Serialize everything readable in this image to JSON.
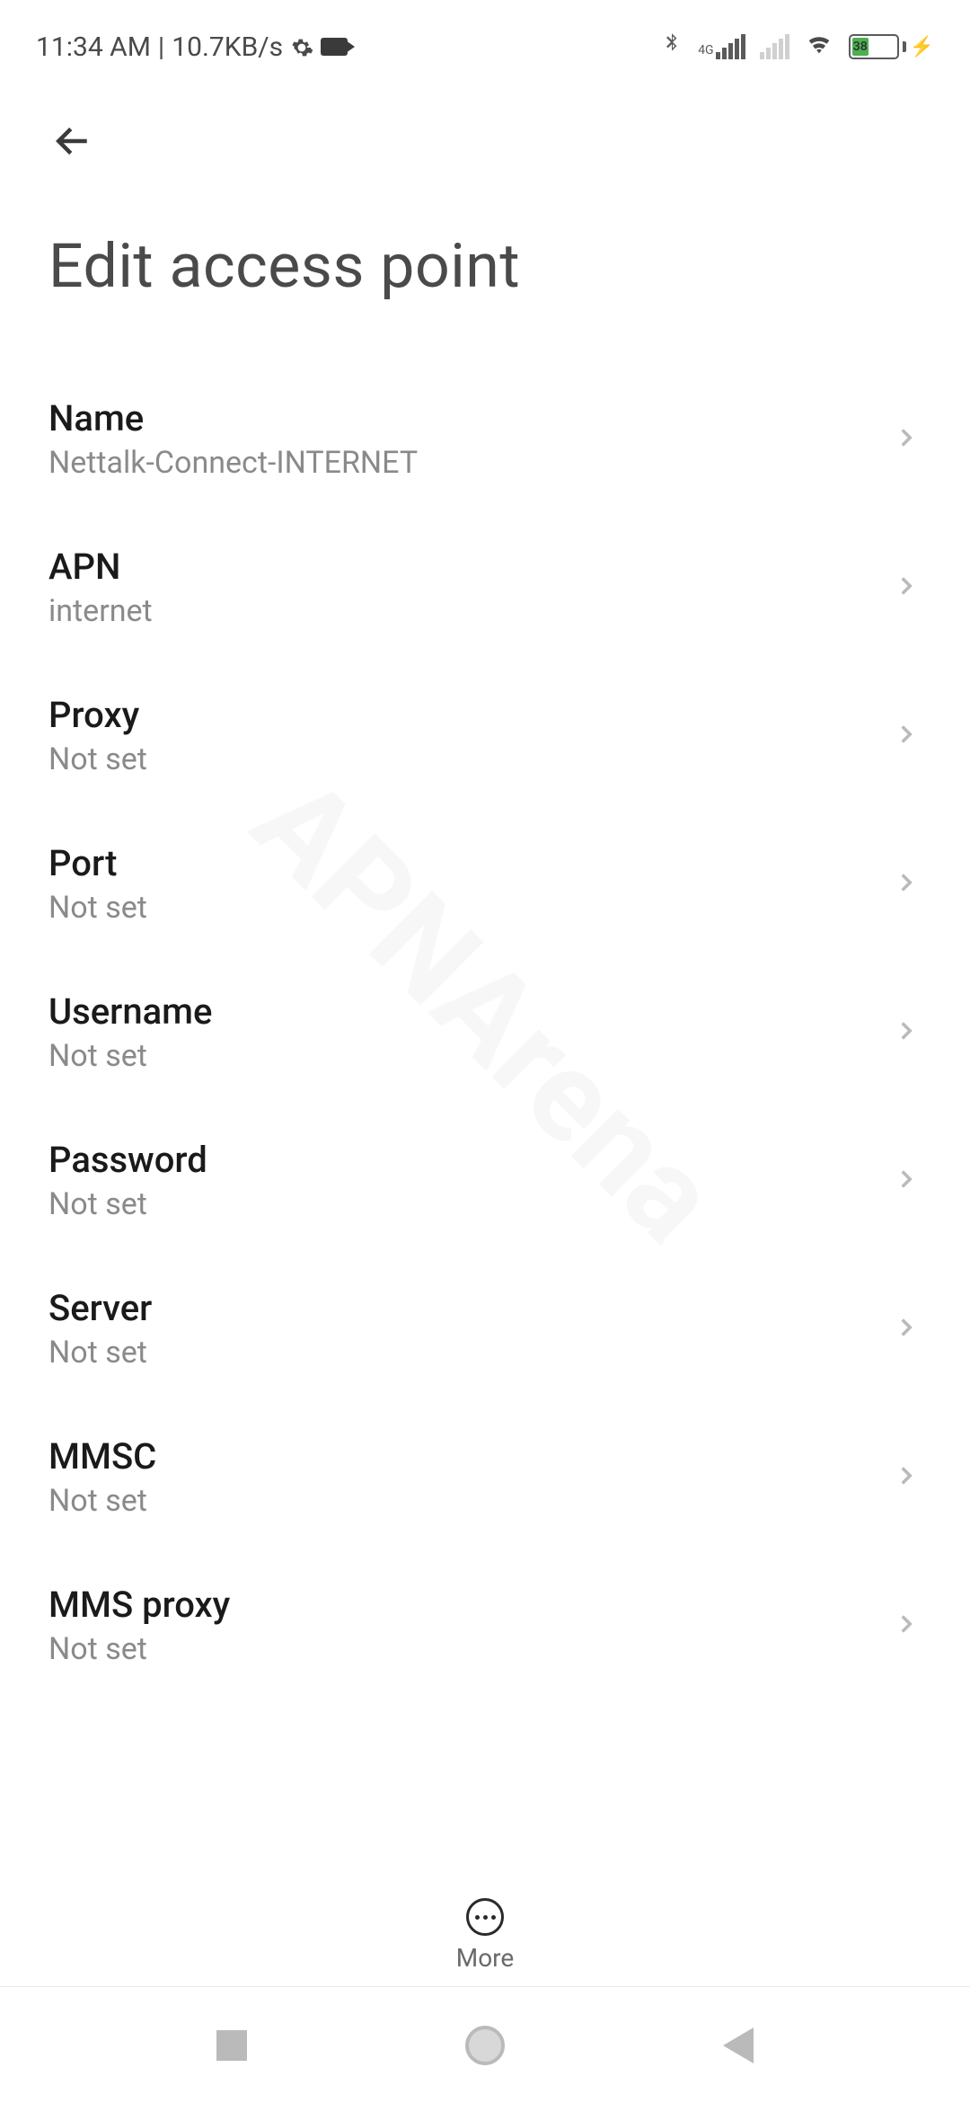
{
  "statusBar": {
    "time": "11:34 AM",
    "separator": "|",
    "dataRate": "10.7KB/s",
    "networkType": "4G",
    "batteryLevel": "38"
  },
  "header": {
    "title": "Edit access point"
  },
  "items": [
    {
      "label": "Name",
      "value": "Nettalk-Connect-INTERNET"
    },
    {
      "label": "APN",
      "value": "internet"
    },
    {
      "label": "Proxy",
      "value": "Not set"
    },
    {
      "label": "Port",
      "value": "Not set"
    },
    {
      "label": "Username",
      "value": "Not set"
    },
    {
      "label": "Password",
      "value": "Not set"
    },
    {
      "label": "Server",
      "value": "Not set"
    },
    {
      "label": "MMSC",
      "value": "Not set"
    },
    {
      "label": "MMS proxy",
      "value": "Not set"
    }
  ],
  "bottomAction": {
    "label": "More"
  }
}
